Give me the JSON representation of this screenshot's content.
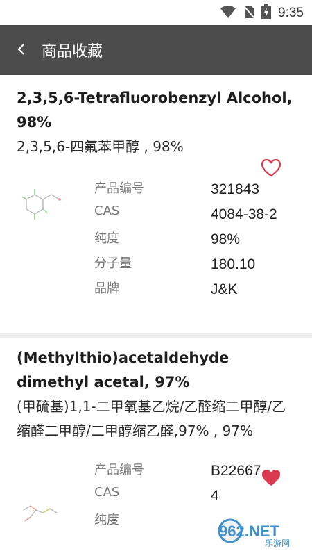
{
  "status": {
    "time": "9:35"
  },
  "appbar": {
    "title": "商品收藏"
  },
  "products": [
    {
      "name_en": "2,3,5,6-Tetrafluorobenzyl Alcohol, 98%",
      "name_zh": "2,3,5,6-四氟苯甲醇 , 98%",
      "favorited": false,
      "fields": [
        {
          "label": "产品编号",
          "value": "321843"
        },
        {
          "label": "CAS",
          "value": "4084-38-2"
        },
        {
          "label": "纯度",
          "value": "98%"
        },
        {
          "label": "分子量",
          "value": "180.10"
        },
        {
          "label": "品牌",
          "value": "J&K"
        }
      ]
    },
    {
      "name_en": "(Methylthio)acetaldehyde dimethyl acetal, 97%",
      "name_zh": "(甲硫基)1,1-二甲氧基乙烷/乙醛缩二甲醇/乙缩醛二甲醇/二甲醇缩乙醛,97% , 97%",
      "favorited": true,
      "fields": [
        {
          "label": "产品编号",
          "value": "B22667"
        },
        {
          "label": "CAS",
          "value": "4"
        },
        {
          "label": "纯度",
          "value": ""
        }
      ]
    }
  ],
  "watermark": {
    "text": "962.NET",
    "subtext": "乐游网"
  },
  "colors": {
    "appbar": "#4c4c4c",
    "heart": "#d93a4e"
  }
}
